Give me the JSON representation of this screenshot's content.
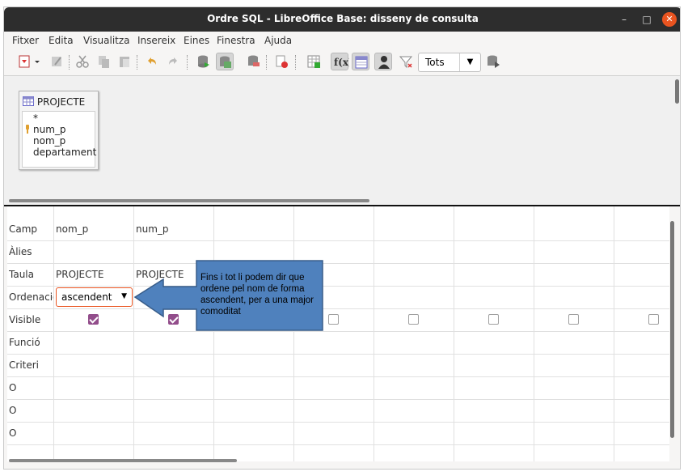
{
  "window": {
    "title": "Ordre SQL - LibreOffice Base: disseny de consulta",
    "minimize": "–",
    "maximize": "□",
    "close": "✕"
  },
  "menu": [
    "Fitxer",
    "Edita",
    "Visualitza",
    "Insereix",
    "Eines",
    "Finestra",
    "Ajuda"
  ],
  "toolbar": {
    "limit_value": "Tots",
    "buttons": [
      "save-icon",
      "dropdown-arrow-icon",
      "edit-icon",
      "cut-icon",
      "copy-icon",
      "paste-icon",
      "undo-icon",
      "redo-icon",
      "run-query-icon",
      "design-view-icon",
      "clear-query-icon",
      "close-icon",
      "add-table-icon",
      "functions-icon",
      "table-names-icon",
      "alias-icon",
      "distinct-values-icon",
      "limit-icon",
      "add-query-icon"
    ],
    "functions_label": "f(x)"
  },
  "table_window": {
    "name": "PROJECTE",
    "fields": [
      "*",
      "num_p",
      "nom_p",
      "departament"
    ],
    "key_field": "num_p"
  },
  "grid": {
    "row_labels": [
      "Camp",
      "Àlies",
      "Taula",
      "Ordenació",
      "Visible",
      "Funció",
      "Criteri",
      "O",
      "O",
      "O"
    ],
    "columns": [
      {
        "field": "nom_p",
        "alias": "",
        "table": "PROJECTE",
        "sort": "ascendent",
        "visible": true
      },
      {
        "field": "num_p",
        "alias": "",
        "table": "PROJECTE",
        "sort": "",
        "visible": true
      },
      {
        "field": "",
        "alias": "",
        "table": "",
        "sort": "",
        "visible": false
      },
      {
        "field": "",
        "alias": "",
        "table": "",
        "sort": "",
        "visible": false
      },
      {
        "field": "",
        "alias": "",
        "table": "",
        "sort": "",
        "visible": false
      },
      {
        "field": "",
        "alias": "",
        "table": "",
        "sort": "",
        "visible": false
      },
      {
        "field": "",
        "alias": "",
        "table": "",
        "sort": "",
        "visible": false
      },
      {
        "field": "",
        "alias": "",
        "table": "",
        "sort": "",
        "visible": false
      }
    ]
  },
  "annotation": {
    "text": "Fins i tot li podem dir que ordene pel nom de forma ascendent, per a una major comoditat",
    "fill_color": "#4f81bd",
    "stroke_color": "#385d8a"
  },
  "colors": {
    "title_bg": "#2d2d2d",
    "close_btn": "#e95420",
    "checkbox_checked": "#924d8b"
  }
}
